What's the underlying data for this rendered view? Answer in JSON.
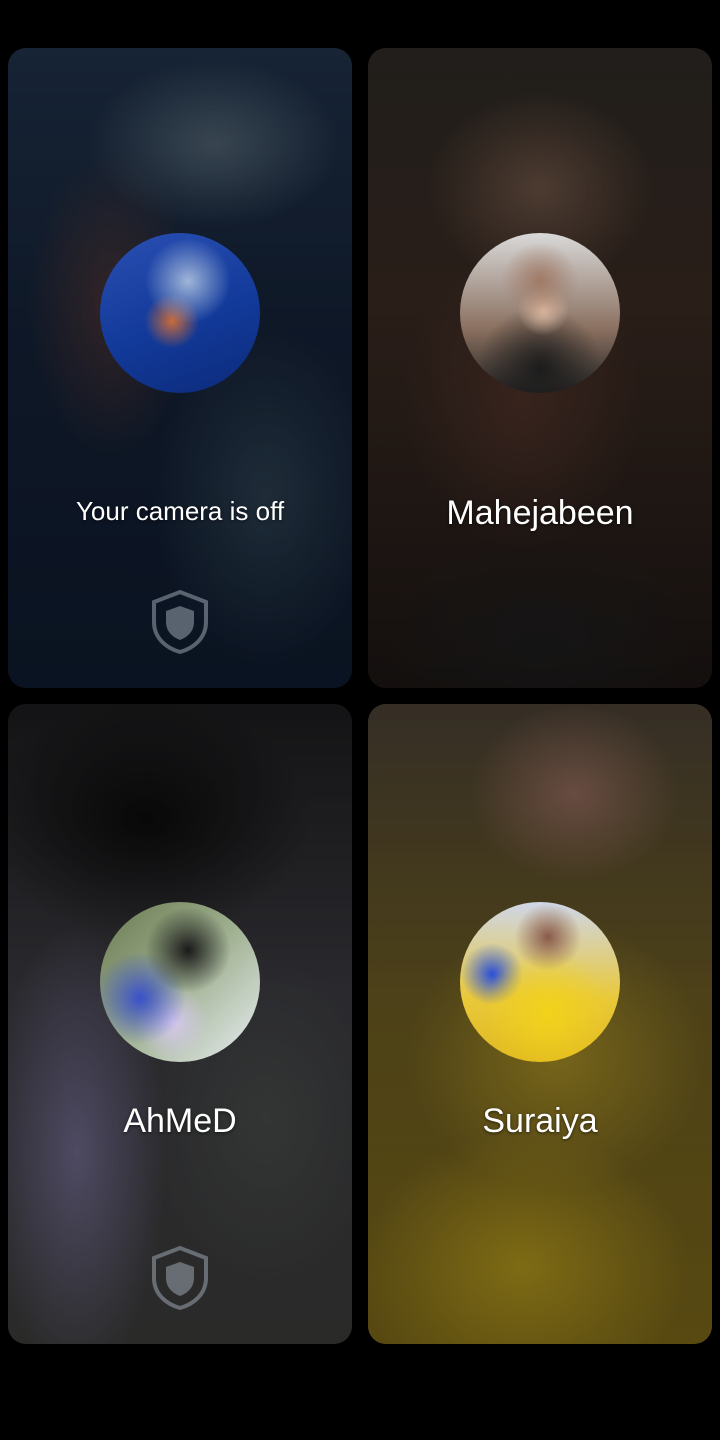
{
  "participants": [
    {
      "label": "Your camera is off",
      "avatar_icon": "user-avatar",
      "badge_icon": "shield-icon"
    },
    {
      "label": "Mahejabeen",
      "avatar_icon": "user-avatar"
    },
    {
      "label": "AhMeD",
      "avatar_icon": "user-avatar",
      "badge_icon": "shield-icon"
    },
    {
      "label": "Suraiya",
      "avatar_icon": "user-avatar"
    }
  ]
}
